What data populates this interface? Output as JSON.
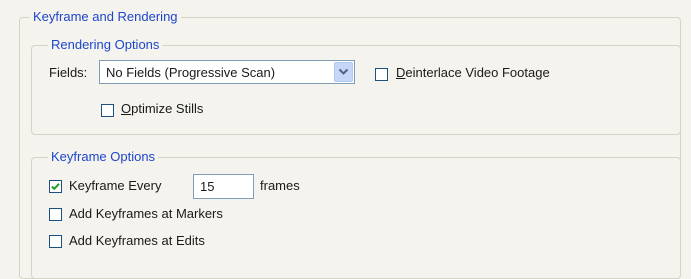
{
  "outer_group": {
    "title": "Keyframe and Rendering"
  },
  "rendering_options": {
    "title": "Rendering Options",
    "fields_label": "Fields:",
    "fields_value": "No Fields (Progressive Scan)",
    "deinterlace": {
      "label_mnemonic": "D",
      "label_rest": "einterlace Video Footage",
      "checked": false
    },
    "optimize_stills": {
      "label_mnemonic": "O",
      "label_rest": "ptimize Stills",
      "checked": false
    }
  },
  "keyframe_options": {
    "title": "Keyframe Options",
    "keyframe_every": {
      "label": "Keyframe Every",
      "checked": true,
      "value": "15",
      "unit": "frames"
    },
    "add_at_markers": {
      "label": "Add Keyframes at Markers",
      "checked": false
    },
    "add_at_edits": {
      "label": "Add Keyframes at Edits",
      "checked": false
    }
  },
  "colors": {
    "title_blue": "#1e46cc",
    "check_green": "#21a121",
    "border": "#d6d3c6"
  },
  "icons": {
    "dropdown": "chevron-down-icon",
    "check": "checkmark-icon"
  }
}
